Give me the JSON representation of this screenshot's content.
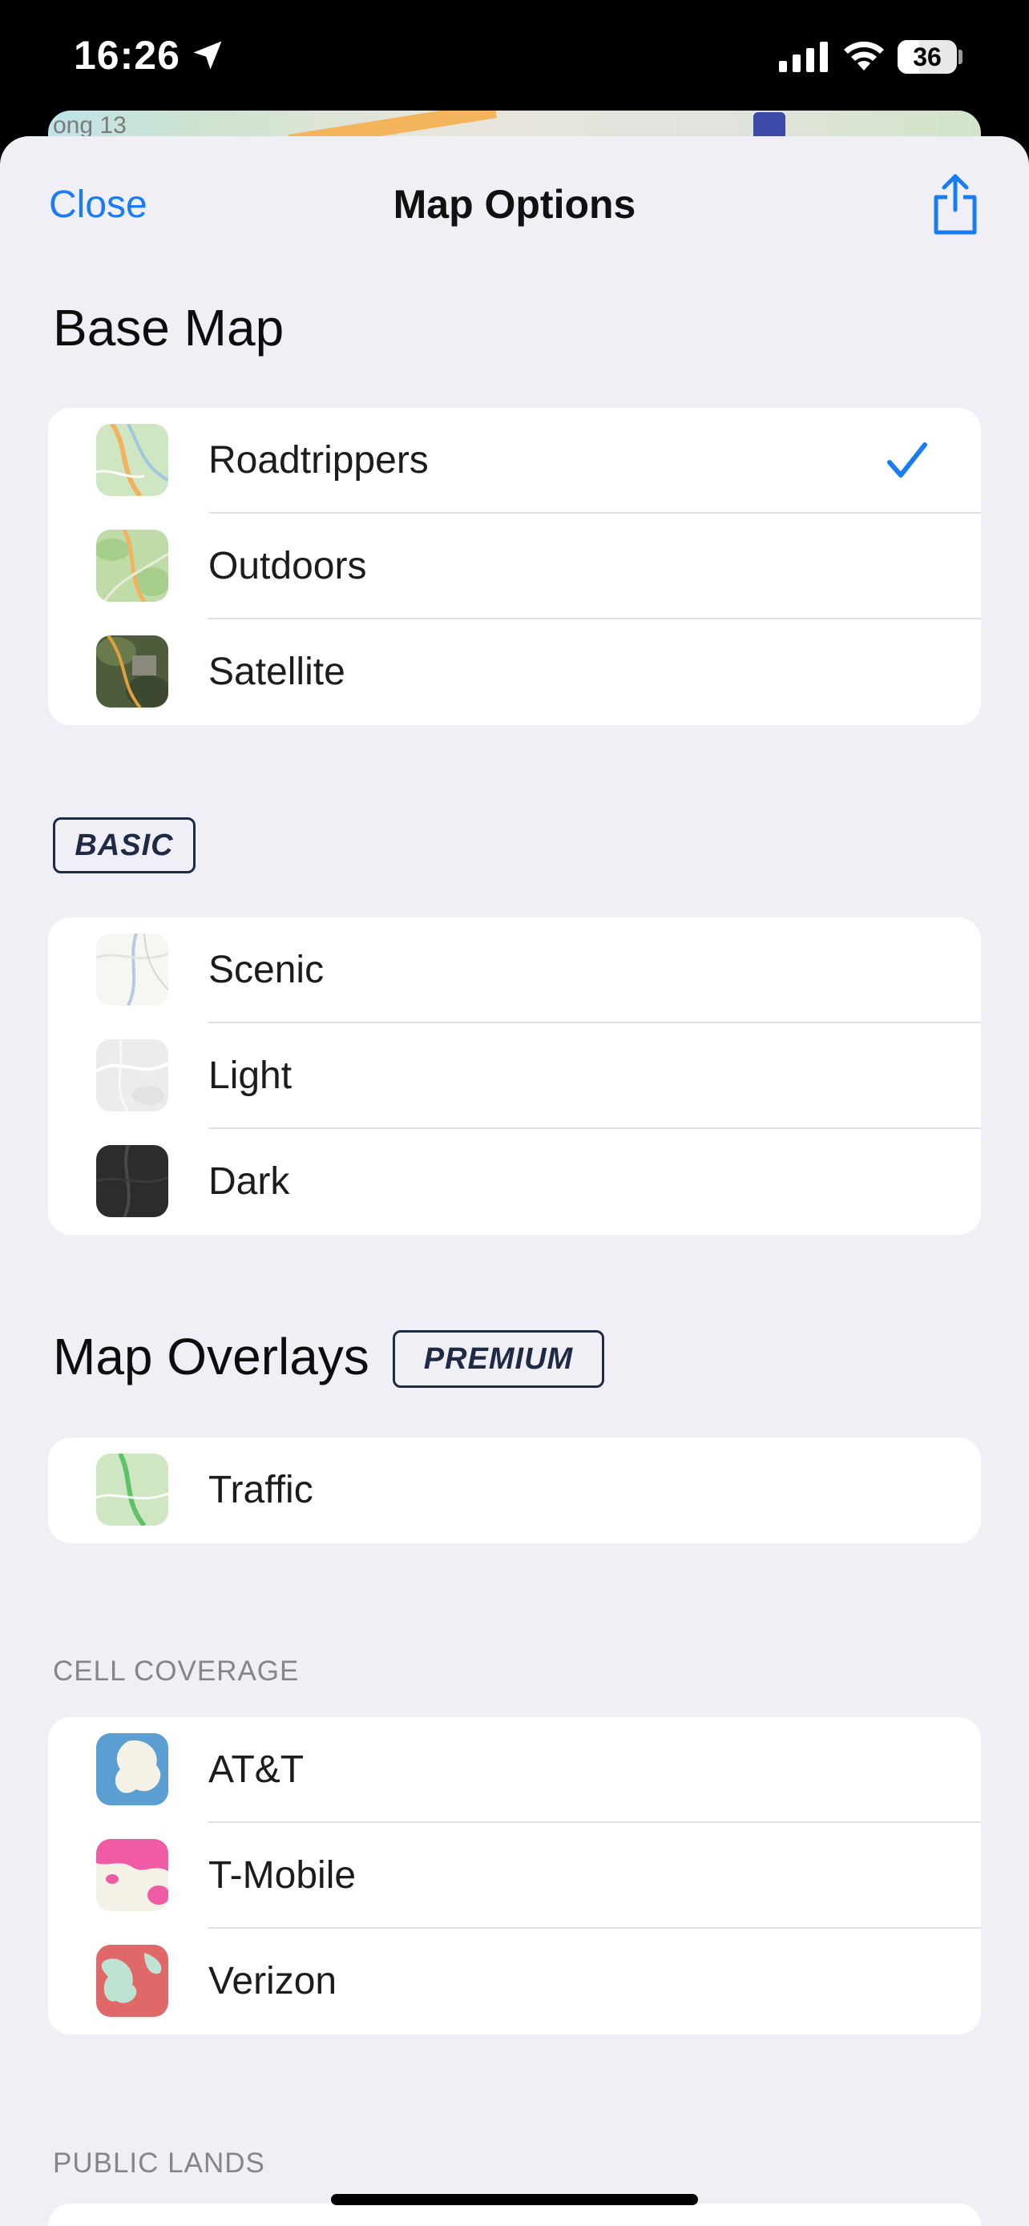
{
  "status_bar": {
    "time": "16:26",
    "battery": "36",
    "battery_level": 0.36
  },
  "map_peek": {
    "label": "ong 13"
  },
  "nav": {
    "close": "Close",
    "title": "Map Options"
  },
  "base_map": {
    "heading": "Base Map",
    "items": [
      {
        "label": "Roadtrippers",
        "selected": true,
        "icon": "roadtrippers-map-thumb"
      },
      {
        "label": "Outdoors",
        "selected": false,
        "icon": "outdoors-map-thumb"
      },
      {
        "label": "Satellite",
        "selected": false,
        "icon": "satellite-map-thumb"
      }
    ]
  },
  "basic": {
    "tag": "BASIC",
    "items": [
      {
        "label": "Scenic",
        "icon": "scenic-map-thumb"
      },
      {
        "label": "Light",
        "icon": "light-map-thumb"
      },
      {
        "label": "Dark",
        "icon": "dark-map-thumb"
      }
    ]
  },
  "overlays": {
    "heading": "Map Overlays",
    "tag": "PREMIUM",
    "items": [
      {
        "label": "Traffic",
        "icon": "traffic-map-thumb"
      }
    ]
  },
  "cell_coverage": {
    "caption": "CELL COVERAGE",
    "items": [
      {
        "label": "AT&T",
        "icon": "att-coverage-thumb"
      },
      {
        "label": "T-Mobile",
        "icon": "tmobile-coverage-thumb"
      },
      {
        "label": "Verizon",
        "icon": "verizon-coverage-thumb"
      }
    ]
  },
  "public_lands": {
    "caption": "PUBLIC LANDS"
  },
  "colors": {
    "accent": "#1a7cf5",
    "background": "#f0eff5",
    "tag_border": "#1f2a44"
  }
}
